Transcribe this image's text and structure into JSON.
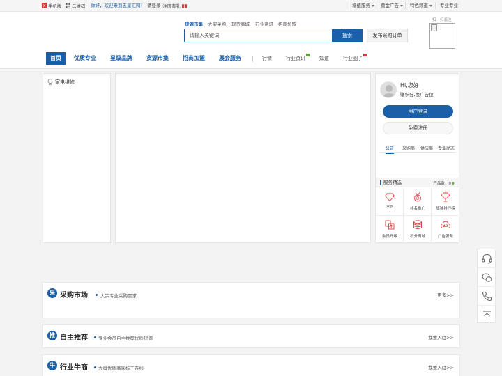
{
  "topbar": {
    "mobile": "手机版",
    "qrcode": "二维码",
    "welcome": "你好，欢迎来到五星汇网！",
    "login": "请登录",
    "register": "注册有礼",
    "right": [
      "增值服务",
      "黄金广告",
      "特色频道",
      "专业专业"
    ]
  },
  "search": {
    "tabs": [
      "货源市集",
      "大宗采购",
      "现货商城",
      "行业资讯",
      "招商加盟"
    ],
    "placeholder": "请输入关键词",
    "button": "搜索",
    "publish": "发布采购订单"
  },
  "qr": {
    "label": "扫一扫关注"
  },
  "nav": {
    "home": "首页",
    "items": [
      "优质专业",
      "星级品牌",
      "货源市集",
      "招商加盟",
      "展会服务"
    ],
    "sub": [
      "行情",
      "行业资讯",
      "知道",
      "行业圈子"
    ]
  },
  "category": {
    "item": "家电维修"
  },
  "user": {
    "hi": "Hi,您好",
    "sub": "赚积分,换广告位",
    "login": "用户登录",
    "register": "免费注册",
    "tabs": [
      "公告",
      "采购商",
      "供应商",
      "专业动态"
    ]
  },
  "services": {
    "title": "服务精选",
    "count": "产品数：0",
    "items": [
      {
        "label": "VIP",
        "icon": "diamond-icon"
      },
      {
        "label": "排名推广",
        "icon": "medal-icon"
      },
      {
        "label": "旗铺排行榜",
        "icon": "trophy-icon"
      },
      {
        "label": "会员升级",
        "icon": "upgrade-icon"
      },
      {
        "label": "积分商城",
        "icon": "coins-icon"
      },
      {
        "label": "广告服务",
        "icon": "ad-cloud-icon"
      }
    ]
  },
  "sections": [
    {
      "badge": "采",
      "title": "采购市场",
      "sub": "大宗专业采购需求",
      "more": "更多>>"
    },
    {
      "badge": "推",
      "title": "自主推荐",
      "sub": "专业会员自主推荐优质货源",
      "more": "我要入驻>>"
    },
    {
      "badge": "牛",
      "title": "行业牛商",
      "sub": "大量优质商家标王在线",
      "more": "我要入驻>>"
    }
  ],
  "colors": {
    "brand": "#1a5fa8",
    "accent_red": "#d9383a"
  }
}
